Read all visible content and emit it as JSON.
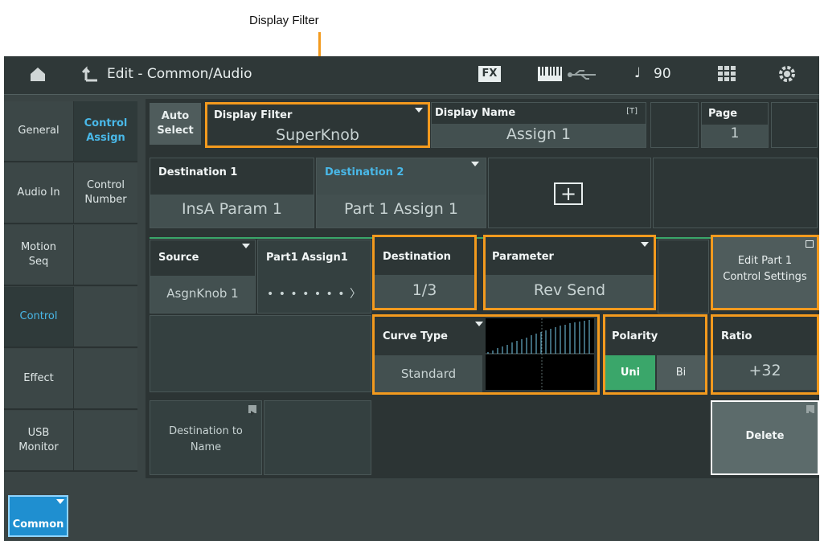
{
  "callout": {
    "label": "Display Filter"
  },
  "header": {
    "title": "Edit - Common/Audio",
    "fx_label": "FX",
    "tempo": "90"
  },
  "sidebar": {
    "items": [
      {
        "label": "General"
      },
      {
        "label": "Audio In"
      },
      {
        "label": "Motion Seq"
      },
      {
        "label": "Control"
      },
      {
        "label": "Effect"
      },
      {
        "label": "USB Monitor"
      }
    ]
  },
  "subtabs": {
    "control_assign": "Control Assign",
    "control_number": "Control Number"
  },
  "auto_select": "Auto Select",
  "display_filter": {
    "label": "Display Filter",
    "value": "SuperKnob"
  },
  "display_name": {
    "label": "Display Name",
    "badge": "[T]",
    "value": "Assign 1"
  },
  "page": {
    "label": "Page",
    "value": "1"
  },
  "destinations": {
    "d1": {
      "label": "Destination 1",
      "value": "InsA Param 1"
    },
    "d2": {
      "label": "Destination 2",
      "value": "Part 1 Assign 1"
    },
    "add_symbol": "+"
  },
  "source": {
    "label": "Source",
    "value": "AsgnKnob 1"
  },
  "part1_assign1": {
    "label": "Part1 Assign1",
    "arrow": "• • • • • • • 〉"
  },
  "destination": {
    "label": "Destination",
    "value": "1/3"
  },
  "parameter": {
    "label": "Parameter",
    "value": "Rev Send"
  },
  "edit_part": {
    "label": "Edit Part 1 Control Settings"
  },
  "curve_type": {
    "label": "Curve Type",
    "value": "Standard"
  },
  "polarity": {
    "label": "Polarity",
    "uni": "Uni",
    "bi": "Bi",
    "selected": "Uni"
  },
  "ratio": {
    "label": "Ratio",
    "value": "+32"
  },
  "dest_to_name": {
    "label": "Destination to Name"
  },
  "delete": {
    "label": "Delete"
  },
  "footer": {
    "common": "Common"
  },
  "colors": {
    "accent": "#49b8e8",
    "highlight": "#f39a1e",
    "polarity_on": "#3aa66a"
  }
}
